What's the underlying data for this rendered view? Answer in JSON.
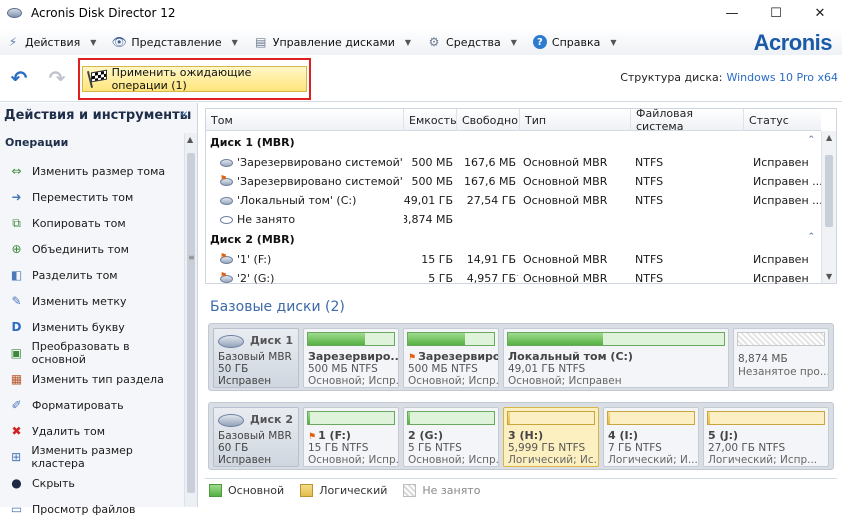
{
  "window": {
    "title": "Acronis Disk Director 12",
    "minimize": "—",
    "maximize": "☐",
    "close": "✕"
  },
  "menu": {
    "items": [
      {
        "label": "Действия",
        "icon": "actions-icon"
      },
      {
        "label": "Представление",
        "icon": "eye-icon"
      },
      {
        "label": "Управление дисками",
        "icon": "disk-management-icon"
      },
      {
        "label": "Средства",
        "icon": "tools-icon"
      },
      {
        "label": "Справка",
        "icon": "help-icon"
      }
    ],
    "brand": "Acronis"
  },
  "toolbar": {
    "apply_label": "Применить ожидающие операции (1)",
    "disk_structure_label": "Структура диска:",
    "disk_structure_value": "Windows 10 Pro x64",
    "highlight_color": "#e02020"
  },
  "left_panel": {
    "title": "Действия и инструменты",
    "collapse": "«",
    "section": "Операции",
    "operations": [
      {
        "label": "Изменить размер тома",
        "icon": "resize-icon"
      },
      {
        "label": "Переместить том",
        "icon": "move-icon"
      },
      {
        "label": "Копировать том",
        "icon": "copy-icon"
      },
      {
        "label": "Объединить том",
        "icon": "merge-icon"
      },
      {
        "label": "Разделить том",
        "icon": "split-icon"
      },
      {
        "label": "Изменить метку",
        "icon": "label-icon"
      },
      {
        "label": "Изменить букву",
        "icon": "letter-icon"
      },
      {
        "label": "Преобразовать в основной",
        "icon": "convert-icon"
      },
      {
        "label": "Изменить тип раздела",
        "icon": "partition-type-icon"
      },
      {
        "label": "Форматировать",
        "icon": "format-icon"
      },
      {
        "label": "Удалить том",
        "icon": "delete-icon"
      },
      {
        "label": "Изменить размер кластера",
        "icon": "cluster-icon"
      },
      {
        "label": "Скрыть",
        "icon": "hide-icon"
      },
      {
        "label": "Просмотр файлов",
        "icon": "browse-files-icon"
      }
    ]
  },
  "table": {
    "columns": [
      "Том",
      "Емкость",
      "Свободно",
      "Тип",
      "Файловая система",
      "Статус"
    ],
    "groups": [
      {
        "title": "Диск 1 (MBR)",
        "rows": [
          {
            "vol": "'Зарезервировано системой' (E:)",
            "cap": "500 МБ",
            "free": "167,6 МБ",
            "type": "Основной MBR",
            "fs": "NTFS",
            "status": "Исправен",
            "flag": false
          },
          {
            "vol": "'Зарезервировано системой'",
            "cap": "500 МБ",
            "free": "167,6 МБ",
            "type": "Основной MBR",
            "fs": "NTFS",
            "status": "Исправен ...",
            "flag": true
          },
          {
            "vol": "'Локальный том' (C:)",
            "cap": "49,01 ГБ",
            "free": "27,54 ГБ",
            "type": "Основной MBR",
            "fs": "NTFS",
            "status": "Исправен ...",
            "flag": false
          },
          {
            "vol": "Не занято",
            "cap": "8,874 МБ",
            "free": "",
            "type": "",
            "fs": "",
            "status": "",
            "flag": false
          }
        ]
      },
      {
        "title": "Диск 2 (MBR)",
        "rows": [
          {
            "vol": "'1' (F:)",
            "cap": "15 ГБ",
            "free": "14,91 ГБ",
            "type": "Основной MBR",
            "fs": "NTFS",
            "status": "Исправен",
            "flag": true
          },
          {
            "vol": "'2' (G:)",
            "cap": "5 ГБ",
            "free": "4,957 ГБ",
            "type": "Основной MBR",
            "fs": "NTFS",
            "status": "Исправен",
            "flag": false
          }
        ]
      }
    ]
  },
  "basic_disks": {
    "title": "Базовые диски (2)",
    "disks": [
      {
        "name": "Диск 1",
        "kind": "Базовый MBR",
        "size": "50 ГБ",
        "status": "Исправен",
        "partitions": [
          {
            "name": "Зарезервиро...",
            "size": "500 МБ NTFS",
            "type": "Основной; Испр...",
            "kind": "basic",
            "used": 0.66,
            "flag": false,
            "selected": false
          },
          {
            "name": "Зарезервиров...",
            "size": "500 МБ NTFS",
            "type": "Основной; Испр...",
            "kind": "basic",
            "used": 0.66,
            "flag": true,
            "selected": false
          },
          {
            "name": "Локальный том (C:)",
            "size": "49,01 ГБ NTFS",
            "type": "Основной; Исправен",
            "kind": "basic",
            "used": 0.44,
            "flag": false,
            "selected": false
          },
          {
            "name": "",
            "size": "8,874 МБ",
            "type": "Незанятое про...",
            "kind": "free",
            "used": 0,
            "flag": false,
            "selected": false
          }
        ]
      },
      {
        "name": "Диск 2",
        "kind": "Базовый MBR",
        "size": "60 ГБ",
        "status": "Исправен",
        "partitions": [
          {
            "name": "1 (F:)",
            "size": "15 ГБ NTFS",
            "type": "Основной; Испр...",
            "kind": "basic",
            "used": 0.02,
            "flag": true,
            "selected": false
          },
          {
            "name": "2 (G:)",
            "size": "5 ГБ NTFS",
            "type": "Основной; Испр...",
            "kind": "basic",
            "used": 0.02,
            "flag": false,
            "selected": false
          },
          {
            "name": "3 (H:)",
            "size": "5,999 ГБ NTFS",
            "type": "Логический; Ис...",
            "kind": "logical",
            "used": 0.02,
            "flag": false,
            "selected": true
          },
          {
            "name": "4 (I:)",
            "size": "7 ГБ NTFS",
            "type": "Логический; И...",
            "kind": "logical",
            "used": 0.02,
            "flag": false,
            "selected": false
          },
          {
            "name": "5 (J:)",
            "size": "27,00 ГБ NTFS",
            "type": "Логический; Испр...",
            "kind": "logical",
            "used": 0.02,
            "flag": false,
            "selected": false
          }
        ]
      }
    ]
  },
  "legend": {
    "basic": "Основной",
    "logical": "Логический",
    "free": "Не занято"
  }
}
